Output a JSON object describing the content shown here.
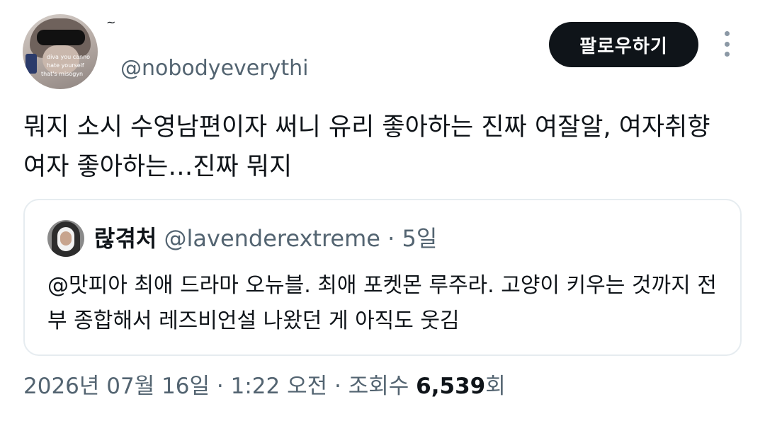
{
  "tweet": {
    "handle": "@nobodyeverythi",
    "avatar_caption_lines": [
      "diva you canno",
      "hate yourself",
      "that's misogyn"
    ],
    "follow_label": "팔로우하기",
    "text": "뭐지 소시 수영남편이자 써니 유리 좋아하는 진짜 여잘알, 여자취향여자 좋아하는…진짜 뭐지"
  },
  "quote": {
    "name": "랂겪처",
    "handle": "@lavenderextreme",
    "separator": "·",
    "time": "5일",
    "text": "@맛피아 최애 드라마 오뉴블. 최애 포켓몬 루주라. 고양이 키우는 것까지 전부 종합해서 레즈비언설  나왔던 게 아직도 웃김"
  },
  "meta": {
    "date": "2026년 07월 16일",
    "separator": "·",
    "time": "1:22 오전",
    "views_label": "조회수",
    "views_count": "6,539",
    "views_suffix": "회"
  },
  "icons": {
    "more": "more-vertical-icon",
    "avatar": "user-avatar"
  },
  "colors": {
    "text_primary": "#0f1419",
    "text_secondary": "#536471",
    "button_bg": "#0f1419",
    "border": "#e6ecf0"
  }
}
